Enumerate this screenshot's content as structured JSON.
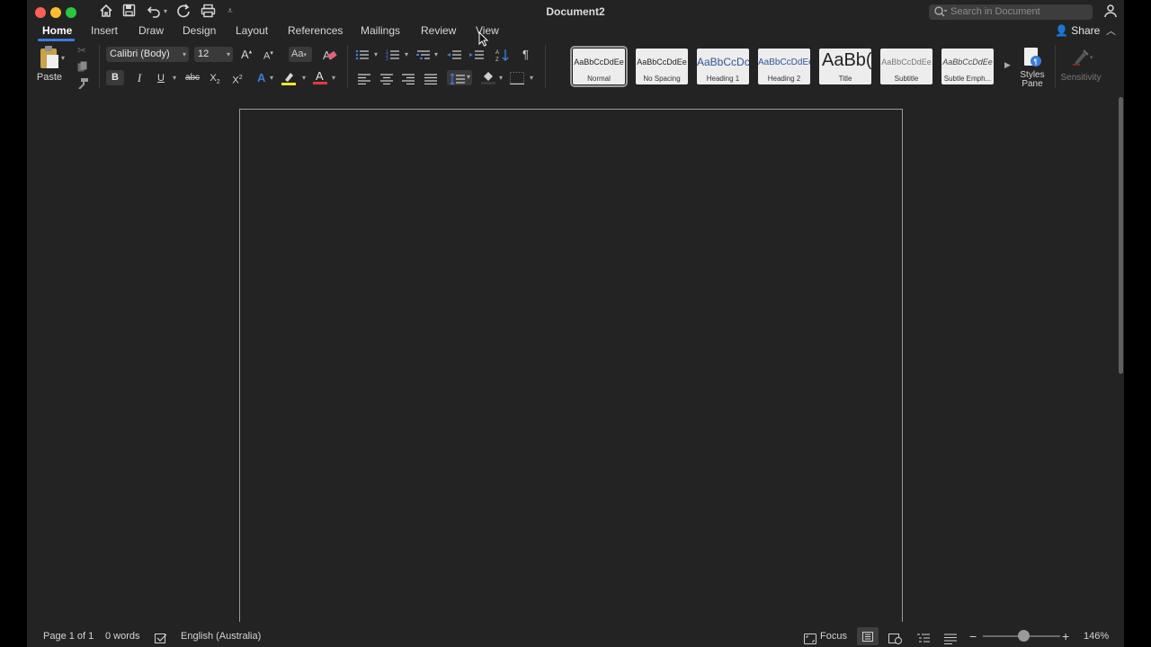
{
  "window": {
    "title": "Document2"
  },
  "search": {
    "placeholder": "Search in Document"
  },
  "tabs": [
    {
      "label": "Home",
      "active": true
    },
    {
      "label": "Insert"
    },
    {
      "label": "Draw"
    },
    {
      "label": "Design"
    },
    {
      "label": "Layout"
    },
    {
      "label": "References"
    },
    {
      "label": "Mailings"
    },
    {
      "label": "Review"
    },
    {
      "label": "View"
    }
  ],
  "share": {
    "label": "Share"
  },
  "ribbon": {
    "paste_label": "Paste",
    "font_name": "Calibri (Body)",
    "font_size": "12",
    "buttons": {
      "bold": "B",
      "italic": "I",
      "underline": "U",
      "strike": "abc",
      "subscript": "X",
      "superscript": "X"
    },
    "styles": [
      {
        "preview": "AaBbCcDdEe",
        "name": "Normal",
        "selected": true
      },
      {
        "preview": "AaBbCcDdEe",
        "name": "No Spacing"
      },
      {
        "preview": "AaBbCcDc",
        "name": "Heading 1"
      },
      {
        "preview": "AaBbCcDdEe",
        "name": "Heading 2"
      },
      {
        "preview": "AaBb(",
        "name": "Title"
      },
      {
        "preview": "AaBbCcDdEe",
        "name": "Subtitle"
      },
      {
        "preview": "AaBbCcDdEe",
        "name": "Subtle Emph..."
      }
    ],
    "styles_pane_label_1": "Styles",
    "styles_pane_label_2": "Pane",
    "sensitivity_label": "Sensitivity"
  },
  "status": {
    "page": "Page 1 of 1",
    "words": "0 words",
    "language": "English (Australia)",
    "focus": "Focus",
    "zoom": "146%"
  },
  "colors": {
    "accent": "#3b7ddb",
    "highlight": "#f5e52a",
    "font_color": "#e03b3b",
    "close": "#fe5f57",
    "minimize": "#febc2e",
    "maximize": "#28c840"
  },
  "zoom_level": 1.46
}
